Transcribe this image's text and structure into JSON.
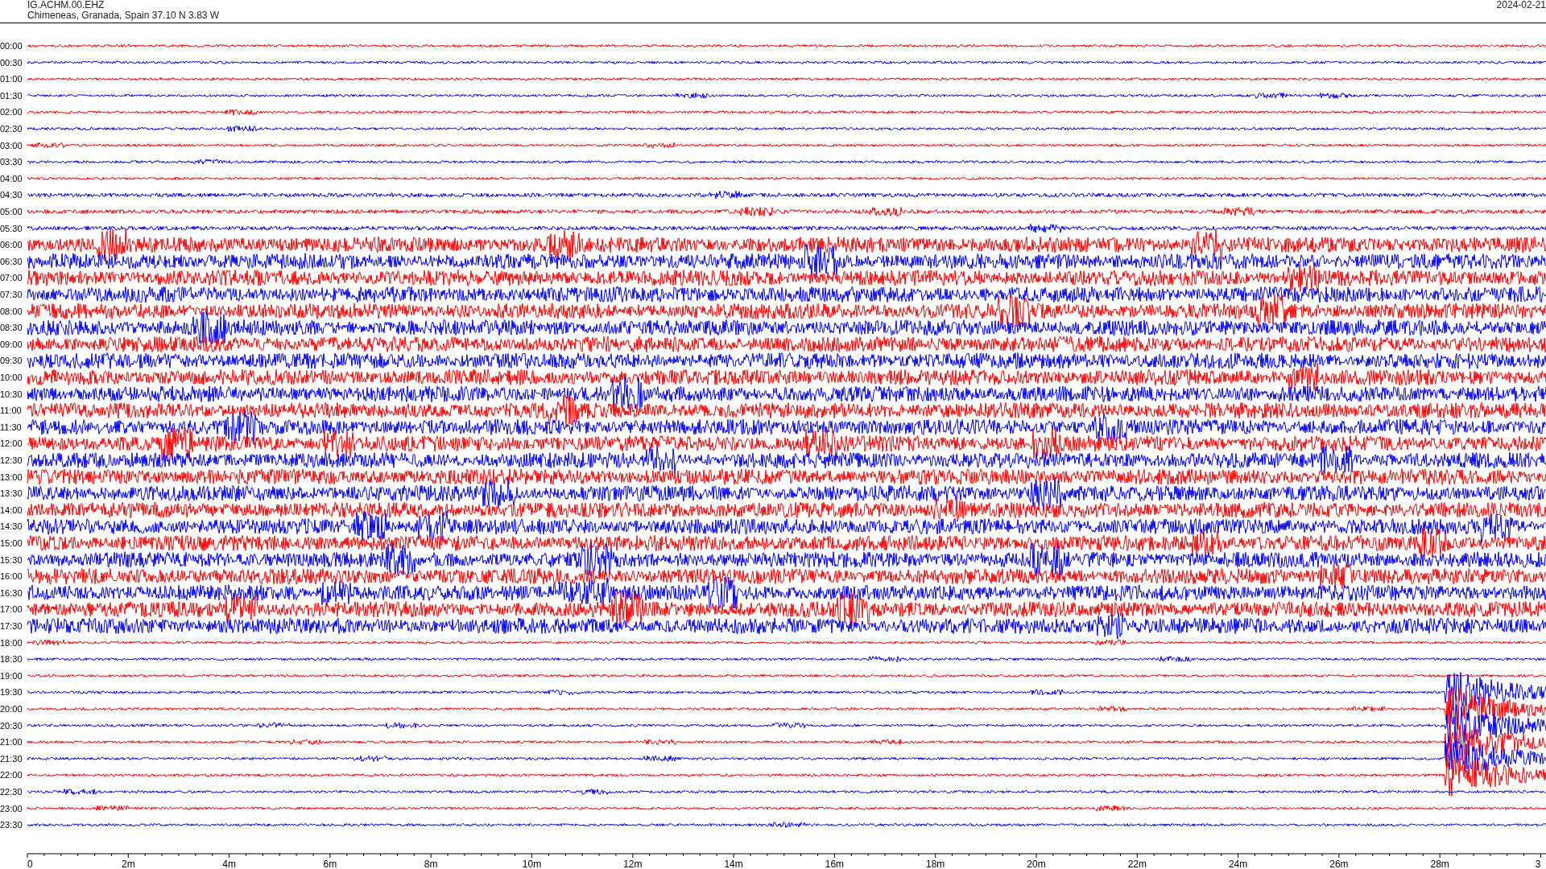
{
  "header": {
    "station": "IG.ACHM.00.EHZ",
    "location": "Chimeneas, Granada, Spain  37.10 N 3.83 W",
    "date": "2024-02-21"
  },
  "rows": [
    {
      "time": "00:00",
      "color": "#ff0000"
    },
    {
      "time": "00:30",
      "color": "#0000ff"
    },
    {
      "time": "01:00",
      "color": "#ff0000"
    },
    {
      "time": "01:30",
      "color": "#0000ff"
    },
    {
      "time": "02:00",
      "color": "#ff0000"
    },
    {
      "time": "02:30",
      "color": "#0000ff"
    },
    {
      "time": "03:00",
      "color": "#ff0000"
    },
    {
      "time": "03:30",
      "color": "#0000ff"
    },
    {
      "time": "04:00",
      "color": "#ff0000"
    },
    {
      "time": "04:30",
      "color": "#0000ff"
    },
    {
      "time": "05:00",
      "color": "#ff0000"
    },
    {
      "time": "05:30",
      "color": "#0000ff"
    },
    {
      "time": "06:00",
      "color": "#ff0000"
    },
    {
      "time": "06:30",
      "color": "#0000ff"
    },
    {
      "time": "07:00",
      "color": "#ff0000"
    },
    {
      "time": "07:30",
      "color": "#0000ff"
    },
    {
      "time": "08:00",
      "color": "#ff0000"
    },
    {
      "time": "08:30",
      "color": "#0000ff"
    },
    {
      "time": "09:00",
      "color": "#ff0000"
    },
    {
      "time": "09:30",
      "color": "#0000ff"
    },
    {
      "time": "10:00",
      "color": "#ff0000"
    },
    {
      "time": "10:30",
      "color": "#0000ff"
    },
    {
      "time": "11:00",
      "color": "#ff0000"
    },
    {
      "time": "11:30",
      "color": "#0000ff"
    },
    {
      "time": "12:00",
      "color": "#ff0000"
    },
    {
      "time": "12:30",
      "color": "#0000ff"
    },
    {
      "time": "13:00",
      "color": "#ff0000"
    },
    {
      "time": "13:30",
      "color": "#0000ff"
    },
    {
      "time": "14:00",
      "color": "#ff0000"
    },
    {
      "time": "14:30",
      "color": "#0000ff"
    },
    {
      "time": "15:00",
      "color": "#ff0000"
    },
    {
      "time": "15:30",
      "color": "#0000ff"
    },
    {
      "time": "16:00",
      "color": "#ff0000"
    },
    {
      "time": "16:30",
      "color": "#0000ff"
    },
    {
      "time": "17:00",
      "color": "#ff0000"
    },
    {
      "time": "17:30",
      "color": "#0000ff"
    },
    {
      "time": "18:00",
      "color": "#ff0000"
    },
    {
      "time": "18:30",
      "color": "#0000ff"
    },
    {
      "time": "19:00",
      "color": "#ff0000"
    },
    {
      "time": "19:30",
      "color": "#0000ff"
    },
    {
      "time": "20:00",
      "color": "#ff0000"
    },
    {
      "time": "20:30",
      "color": "#0000ff"
    },
    {
      "time": "21:00",
      "color": "#ff0000"
    },
    {
      "time": "21:30",
      "color": "#0000ff"
    },
    {
      "time": "22:00",
      "color": "#ff0000"
    },
    {
      "time": "22:30",
      "color": "#0000ff"
    },
    {
      "time": "23:00",
      "color": "#ff0000"
    },
    {
      "time": "23:30",
      "color": "#0000ff"
    }
  ],
  "x_axis": {
    "labels": [
      "0",
      "2m",
      "4m",
      "6m",
      "8m",
      "10m",
      "12m",
      "14m",
      "16m",
      "18m",
      "20m",
      "22m",
      "24m",
      "26m",
      "28m",
      "3"
    ]
  }
}
